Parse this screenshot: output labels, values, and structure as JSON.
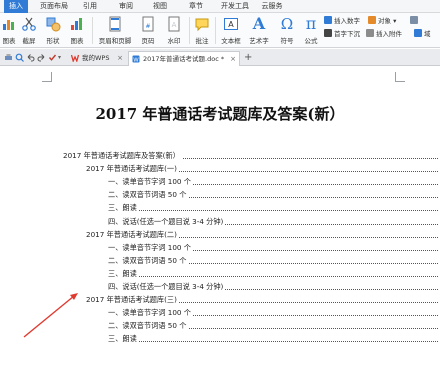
{
  "menu": {
    "tabs": [
      "插入",
      "页面布局",
      "引用",
      "审阅",
      "视图",
      "章节",
      "开发工具",
      "云服务"
    ],
    "active_tab": "插入"
  },
  "ribbon": {
    "buttons": [
      "图表",
      "截屏",
      "形状",
      "图表",
      "页眉和页脚",
      "页码",
      "水印",
      "批注",
      "文本框",
      "艺术字",
      "符号",
      "公式"
    ],
    "small_items": [
      "插入数字",
      "对象",
      "首字下沉",
      "插入附件",
      "域"
    ],
    "math_glyph": "π",
    "omega_glyph": "Ω",
    "text_glyph": "A"
  },
  "tabbar": {
    "tabs": [
      {
        "label": "我的WPS"
      },
      {
        "label": "2017年普通话考试题.doc *"
      }
    ],
    "add_label": "+"
  },
  "document": {
    "title": "2017 年普通话考试题库及答案(新）",
    "toc": [
      {
        "level": 0,
        "text": "2017 年普通话考试题库及答案(新）"
      },
      {
        "level": 1,
        "text": "2017 年普通话考试题库(一)"
      },
      {
        "level": 2,
        "text": "一、读单音节字词 100 个"
      },
      {
        "level": 2,
        "text": "二、读双音节词语 50 个"
      },
      {
        "level": 2,
        "text": "三、朗读"
      },
      {
        "level": 2,
        "text": "四、说话(任选一个题目说 3-4 分钟)"
      },
      {
        "level": 1,
        "text": "2017 年普通话考试题库(二)"
      },
      {
        "level": 2,
        "text": "一、读单音节字词 100 个"
      },
      {
        "level": 2,
        "text": "二、读双音节词语 50 个"
      },
      {
        "level": 2,
        "text": "三、朗读"
      },
      {
        "level": 2,
        "text": "四、说话(任选一个题目说 3-4 分钟)"
      },
      {
        "level": 1,
        "text": "2017 年普通话考试题库(三)"
      },
      {
        "level": 2,
        "text": "一、读单音节字词 100 个"
      },
      {
        "level": 2,
        "text": "二、读双音节词语 50 个"
      },
      {
        "level": 2,
        "text": "三、朗读"
      }
    ]
  },
  "colors": {
    "accent": "#2f7bd6",
    "arrow": "#e03a2f"
  }
}
